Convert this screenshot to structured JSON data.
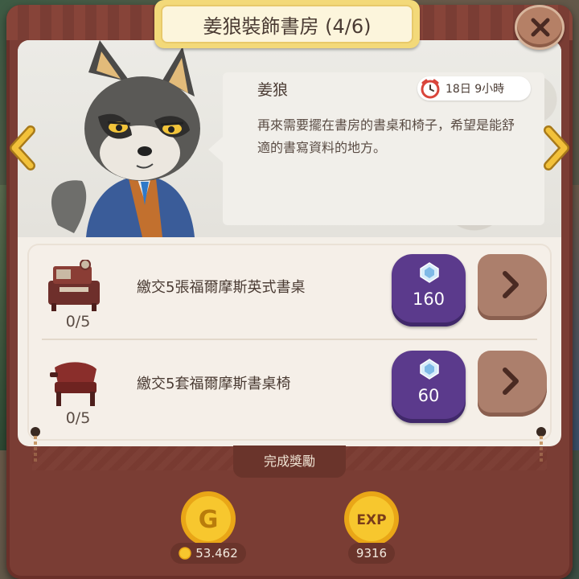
{
  "title": "姜狼裝飾書房 (4/6)",
  "npc": {
    "name": "姜狼",
    "timer": "18日 9小時",
    "dialog": "再來需要擺在書房的書桌和椅子，希望是能舒適的書寫資料的地方。"
  },
  "tasks": [
    {
      "label": "繳交5張福爾摩斯英式書桌",
      "count": "0/5",
      "gem_cost": "160"
    },
    {
      "label": "繳交5套福爾摩斯書桌椅",
      "count": "0/5",
      "gem_cost": "60"
    }
  ],
  "rewards": {
    "label": "完成獎勵",
    "gold": "53.462",
    "exp": "9316"
  },
  "icons": {
    "close": "close-icon",
    "prev": "chevron-left-icon",
    "next": "chevron-right-icon",
    "timer": "alarm-clock-icon",
    "gem": "diamond-icon",
    "go": "chevron-right-icon",
    "gold": "gold-coin-icon",
    "exp": "exp-coin-icon"
  },
  "colors": {
    "frame": "#7a3d34",
    "gem_button": "#5b3a8c",
    "go_button": "#ac7f6c",
    "arrow": "#f2c13a",
    "title_banner": "#f3d979"
  }
}
